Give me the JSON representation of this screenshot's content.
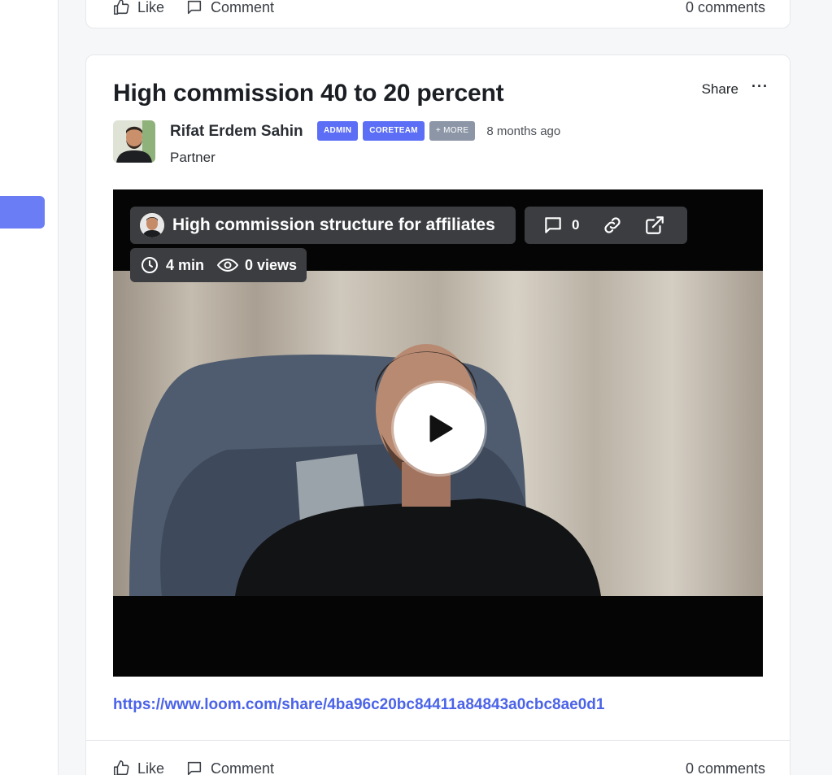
{
  "prev_post": {
    "like_label": "Like",
    "comment_label": "Comment",
    "comments_count": "0 comments"
  },
  "post": {
    "title": "High commission 40 to 20 percent",
    "share_label": "Share",
    "more_label": "···",
    "author": {
      "name": "Rifat Erdem Sahin",
      "role": "Partner",
      "badges": [
        "ADMIN",
        "CORETEAM",
        "+ MORE"
      ],
      "time_ago": "8 months ago"
    },
    "video": {
      "title": "High commission structure for affiliates",
      "comment_count": "0",
      "duration": "4 min",
      "views": "0 views"
    },
    "link": "https://www.loom.com/share/4ba96c20bc84411a84843a0cbc8ae0d1",
    "like_label": "Like",
    "comment_label": "Comment",
    "comments_count": "0 comments"
  },
  "colors": {
    "accent": "#5b6ef5",
    "link": "#4b63e8",
    "badge_more": "#8c96a6"
  },
  "icons": [
    "thumbs-up-icon",
    "comment-icon",
    "clock-icon",
    "eye-icon",
    "link-icon",
    "external-link-icon",
    "play-icon"
  ]
}
